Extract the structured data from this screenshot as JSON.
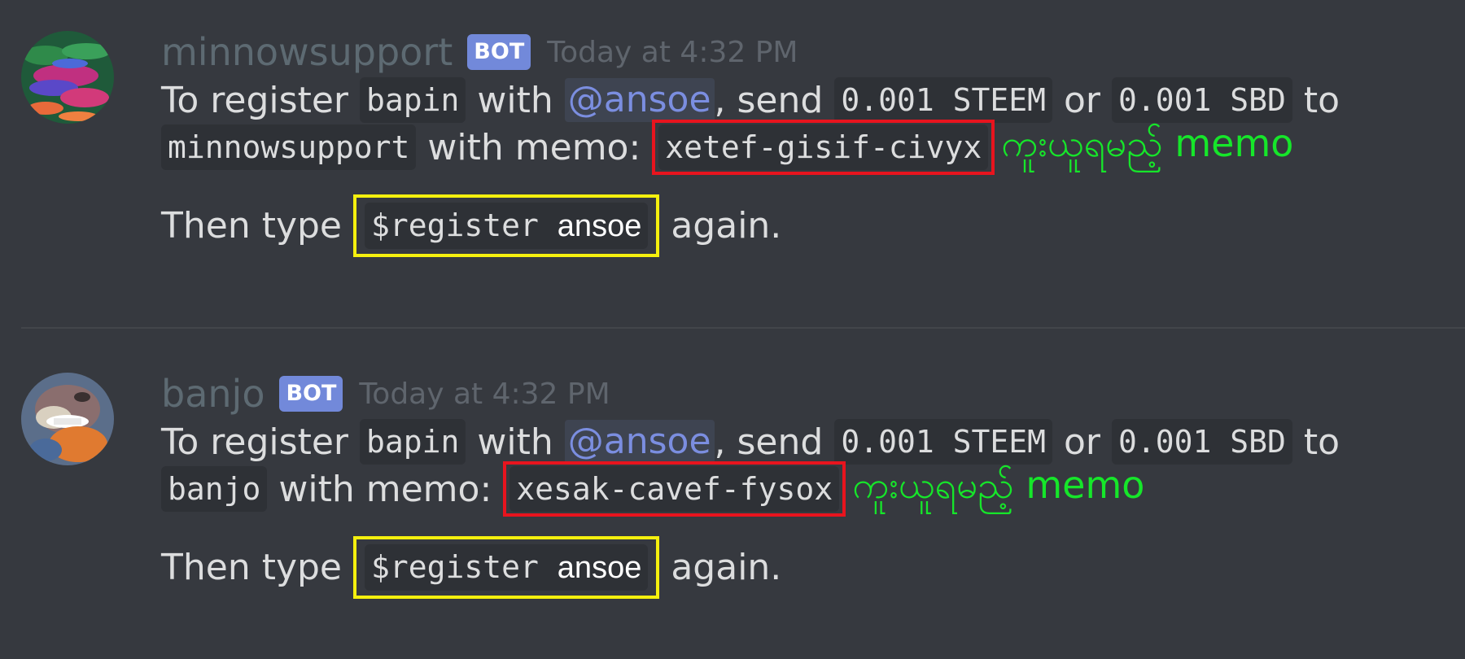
{
  "messages": [
    {
      "username": "minnowsupport",
      "bot_tag": "BOT",
      "timestamp": "Today at 4:32 PM",
      "text_to_register": "To register",
      "code_bapin": "bapin",
      "text_with": "with",
      "mention": "@ansoe",
      "text_send": ", send",
      "code_steem": "0.001 STEEM",
      "text_or": "or",
      "code_sbd": "0.001 SBD",
      "text_to": "to",
      "code_account": "minnowsupport",
      "text_with_memo": "with memo:",
      "code_memo": "xetef-gisif-civyx",
      "annotation": "ကူးယူရမည့် memo",
      "text_then_type": "Then type",
      "code_command": "$register",
      "command_arg": "ansoe",
      "text_again": "again."
    },
    {
      "username": "banjo",
      "bot_tag": "BOT",
      "timestamp": "Today at 4:32 PM",
      "text_to_register": "To register",
      "code_bapin": "bapin",
      "text_with": "with",
      "mention": "@ansoe",
      "text_send": ", send",
      "code_steem": "0.001 STEEM",
      "text_or": "or",
      "code_sbd": "0.001 SBD",
      "text_to": "to",
      "code_account": "banjo",
      "text_with_memo": "with memo:",
      "code_memo": "xesak-cavef-fysox",
      "annotation": "ကူးယူရမည့် memo",
      "text_then_type": "Then type",
      "code_command": "$register",
      "command_arg": "ansoe",
      "text_again": "again."
    }
  ],
  "colors": {
    "background": "#36393f",
    "username": "#5d6a72",
    "bot_tag": "#7289da",
    "mention": "#7b8ee0",
    "highlight_red": "#e8141e",
    "highlight_yellow": "#f5f00e",
    "annotation_green": "#16e62a"
  }
}
